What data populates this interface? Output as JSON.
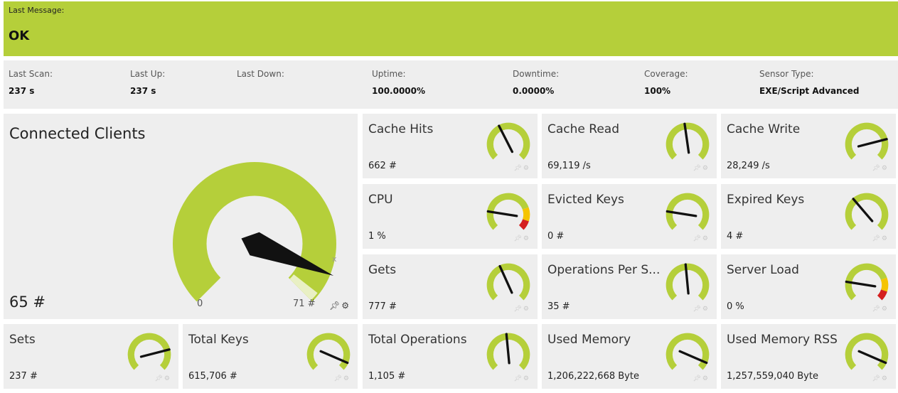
{
  "status": {
    "label": "Last Message:",
    "value": "OK",
    "color": "#b5cf3a"
  },
  "info": [
    {
      "label": "Last Scan:",
      "value": "237 s"
    },
    {
      "label": "Last Up:",
      "value": "237 s"
    },
    {
      "label": "Last Down:",
      "value": ""
    },
    {
      "label": "Uptime:",
      "value": "100.0000%"
    },
    {
      "label": "Downtime:",
      "value": "0.0000%"
    },
    {
      "label": "Coverage:",
      "value": "100%"
    },
    {
      "label": "Sensor Type:",
      "value": "EXE/Script Advanced"
    }
  ],
  "main_gauge": {
    "title": "Connected Clients",
    "value": "65 #",
    "min_label": "0",
    "max_label": "71 #",
    "marker_label": "x",
    "fraction": 0.915
  },
  "channels": [
    {
      "title": "Cache Hits",
      "value": "662 #",
      "fraction": 0.4,
      "warning_zone": false
    },
    {
      "title": "Cache Read",
      "value": "69,119 /s",
      "fraction": 0.47,
      "warning_zone": false
    },
    {
      "title": "Cache Write",
      "value": "28,249 /s",
      "fraction": 0.78,
      "warning_zone": false
    },
    {
      "title": "CPU",
      "value": "1 %",
      "fraction": 0.2,
      "warning_zone": true
    },
    {
      "title": "Evicted Keys",
      "value": "0 #",
      "fraction": 0.2,
      "warning_zone": false
    },
    {
      "title": "Expired Keys",
      "value": "4 #",
      "fraction": 0.35,
      "warning_zone": false
    },
    {
      "title": "Gets",
      "value": "777 #",
      "fraction": 0.41,
      "warning_zone": false
    },
    {
      "title": "Operations Per S...",
      "value": "35 #",
      "fraction": 0.48,
      "warning_zone": false
    },
    {
      "title": "Server Load",
      "value": "0 %",
      "fraction": 0.2,
      "warning_zone": true
    },
    {
      "title": "Sets",
      "value": "237 #",
      "fraction": 0.78,
      "warning_zone": false
    },
    {
      "title": "Total Keys",
      "value": "615,706 #",
      "fraction": 0.92,
      "warning_zone": false
    },
    {
      "title": "Total Operations",
      "value": "1,105 #",
      "fraction": 0.48,
      "warning_zone": false
    },
    {
      "title": "Used Memory",
      "value": "1,206,222,668 Byte",
      "fraction": 0.92,
      "warning_zone": false
    },
    {
      "title": "Used Memory RSS",
      "value": "1,257,559,040 Byte",
      "fraction": 0.92,
      "warning_zone": false
    }
  ],
  "icons": {
    "pin": "pin-icon",
    "settings": "gear-icon"
  },
  "colors": {
    "gauge_green": "#b5cf3a",
    "warning_yellow": "#f5c400",
    "error_red": "#d42020",
    "needle": "#111111",
    "tile_bg": "#eeeeee"
  }
}
